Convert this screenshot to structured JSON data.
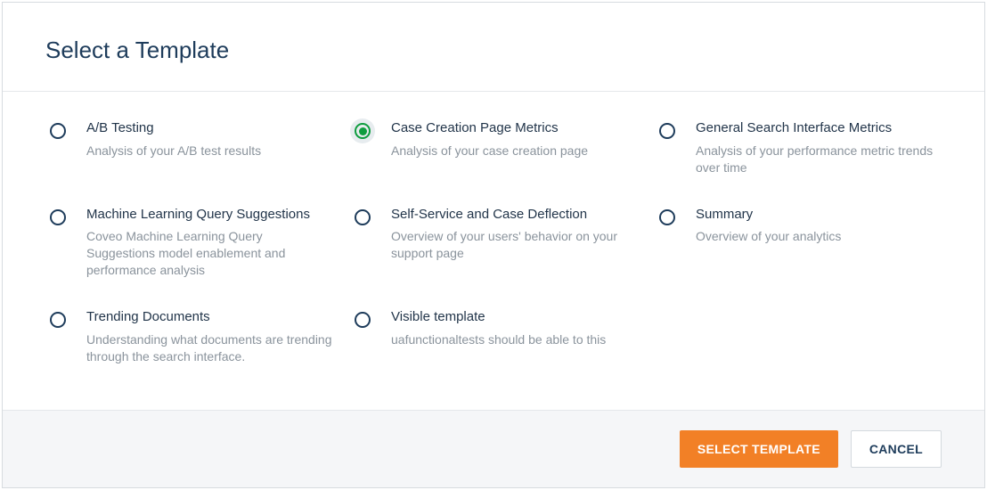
{
  "header": {
    "title": "Select a Template"
  },
  "templates": [
    {
      "name": "A/B Testing",
      "description": "Analysis of your A/B test results",
      "selected": false
    },
    {
      "name": "Case Creation Page Metrics",
      "description": "Analysis of your case creation page",
      "selected": true
    },
    {
      "name": "General Search Interface Metrics",
      "description": "Analysis of your performance metric trends over time",
      "selected": false
    },
    {
      "name": "Machine Learning Query Suggestions",
      "description": "Coveo Machine Learning Query Suggestions model enablement and performance analysis",
      "selected": false
    },
    {
      "name": "Self-Service and Case Deflection",
      "description": "Overview of your users' behavior on your support page",
      "selected": false
    },
    {
      "name": "Summary",
      "description": "Overview of your analytics",
      "selected": false
    },
    {
      "name": "Trending Documents",
      "description": "Understanding what documents are trending through the search interface.",
      "selected": false
    },
    {
      "name": "Visible template",
      "description": "uafunctionaltests should be able to this",
      "selected": false
    }
  ],
  "footer": {
    "select_label": "Select Template",
    "cancel_label": "Cancel"
  }
}
